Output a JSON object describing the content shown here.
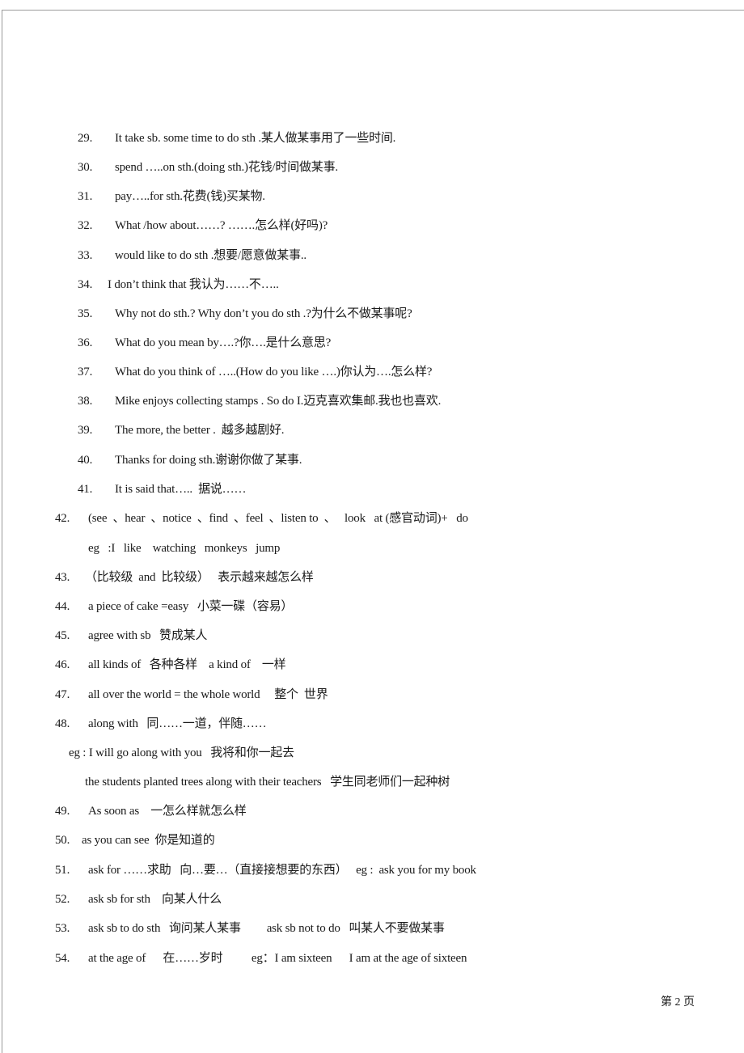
{
  "document": {
    "items": [
      {
        "number": "29.",
        "text": "It take sb. some time to do sth .某人做某事用了一些时间."
      },
      {
        "number": "30.",
        "text": "spend …..on sth.(doing sth.)花钱/时间做某事."
      },
      {
        "number": "31.",
        "text": "pay…..for sth.花费(钱)买某物."
      },
      {
        "number": "32.",
        "text": "What /how about……? …….怎么样(好吗)?"
      },
      {
        "number": "33.",
        "text": "would like to do sth .想要/愿意做某事.."
      },
      {
        "number": "34.",
        "text": "I don’t think that 我认为……不….."
      },
      {
        "number": "35.",
        "text": "Why not do sth.? Why don’t you do sth .?为什么不做某事呢?"
      },
      {
        "number": "36.",
        "text": "What do you mean by….?你….是什么意思?"
      },
      {
        "number": "37.",
        "text": "What do you think of …..(How do you like ….)你认为….怎么样?"
      },
      {
        "number": "38.",
        "text": "Mike enjoys collecting stamps . So do I.迈克喜欢集邮.我也也喜欢."
      },
      {
        "number": "39.",
        "text": "The more, the better .  越多越剧好."
      },
      {
        "number": "40.",
        "text": "Thanks for doing sth.谢谢你做了某事."
      },
      {
        "number": "41.",
        "text": "It is said that…..  据说……"
      },
      {
        "number": "42.",
        "text": "(see  、hear  、notice  、find  、feel  、listen to  、   look   at (感官动词)+   do"
      },
      {
        "number": "",
        "text": "eg   :I   like    watching   monkeys   jump"
      },
      {
        "number": "43.",
        "text": "（比较级  and  比较级）   表示越来越怎么样"
      },
      {
        "number": "44.",
        "text": "a piece of cake =easy   小菜一碟（容易）"
      },
      {
        "number": "45.",
        "text": "agree with sb   赞成某人"
      },
      {
        "number": "46.",
        "text": "all kinds of   各种各样    a kind of    一样"
      },
      {
        "number": "47.",
        "text": "all over the world = the whole world     整个  世界"
      },
      {
        "number": "48.",
        "text": "along with   同……一道，伴随……"
      },
      {
        "number": "",
        "text": "eg : I will go along with you   我将和你一起去"
      },
      {
        "number": "",
        "text": "the students planted trees along with their teachers   学生同老师们一起种树"
      },
      {
        "number": "49.",
        "text": "As soon as    一怎么样就怎么样"
      },
      {
        "number": "50.",
        "text": "as you can see  你是知道的"
      },
      {
        "number": "51.",
        "text": "ask for ……求助   向…要…（直接接想要的东西）   eg :  ask you for my book"
      },
      {
        "number": "52.",
        "text": "ask sb for sth    向某人什么"
      },
      {
        "number": "53.",
        "text": "ask sb to do sth   询问某人某事         ask sb not to do   叫某人不要做某事"
      },
      {
        "number": "54.",
        "text": "at the age of      在……岁时          eg：I am sixteen      I am at the age of sixteen"
      }
    ]
  },
  "footer": {
    "page_label": "第 2 页"
  }
}
